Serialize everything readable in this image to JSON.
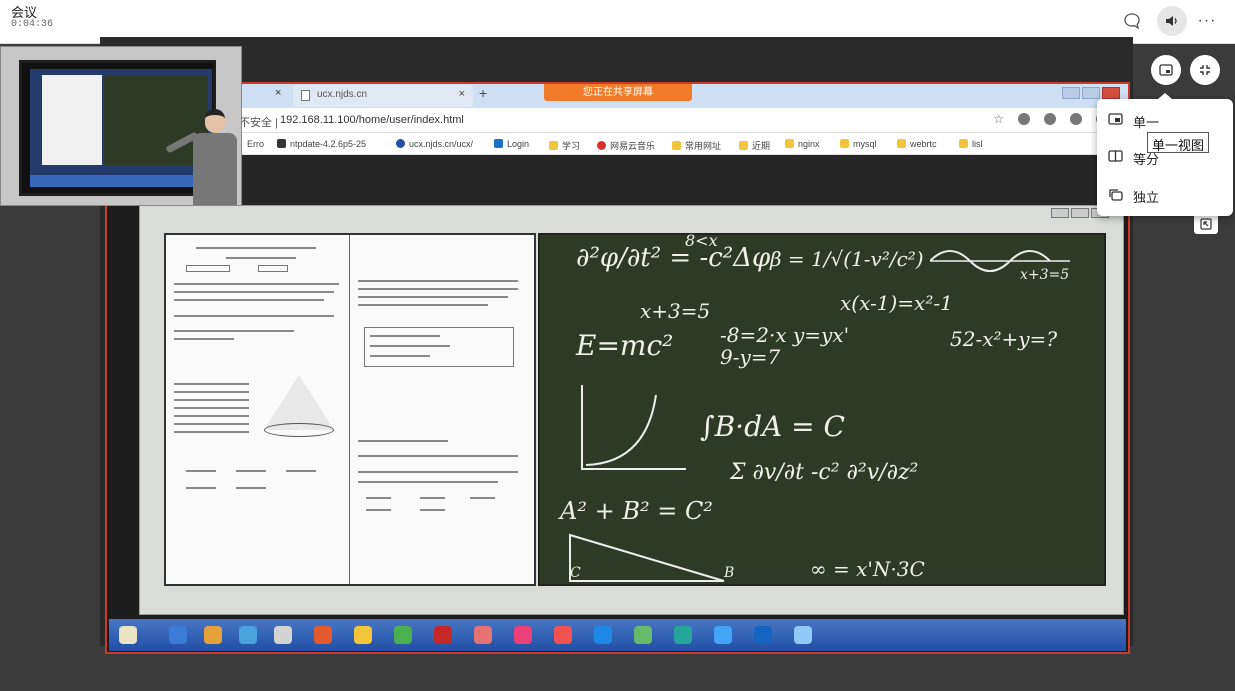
{
  "meeting": {
    "title": "会议",
    "timer": "0:04:36"
  },
  "toolbar": {
    "more_label": "···"
  },
  "shared_screen": {
    "sharing_banner": "您正在共享屏幕",
    "tabs": [
      {
        "label": "ucx.njds.cn"
      }
    ],
    "tab_close": "×",
    "new_tab": "+",
    "address_prefix": "不安全 |",
    "url": "192.168.11.100/home/user/index.html",
    "bookmarks": [
      {
        "label": "Erro",
        "icon": "error-icon"
      },
      {
        "label": "ntpdate-4.2.6p5-25",
        "icon": "page-icon"
      },
      {
        "label": "ucx.njds.cn/ucx/",
        "icon": "site-icon"
      },
      {
        "label": "Login",
        "icon": "login-icon"
      },
      {
        "label": "学习",
        "icon": "folder-icon"
      },
      {
        "label": "网易云音乐",
        "icon": "music-icon"
      },
      {
        "label": "常用网址",
        "icon": "folder-icon"
      },
      {
        "label": "近期",
        "icon": "folder-icon"
      },
      {
        "label": "nginx",
        "icon": "folder-icon"
      },
      {
        "label": "mysql",
        "icon": "folder-icon"
      },
      {
        "label": "webrtc",
        "icon": "folder-icon"
      },
      {
        "label": "lisl",
        "icon": "folder-icon"
      }
    ],
    "chalkboard_formulas": [
      "∂²φ/∂t² = -c²Δφ",
      "8<x",
      "β = 1/√(1-v²/c²)",
      "x+3=5",
      "x(x-1)=x²-1",
      "x+3=5",
      "E=mc²",
      "-8=2·x  y=yx'",
      "9-y=7",
      "52-x²+y=?",
      "∫B·dA = C",
      "Σ ∂v/∂t  -c²  ∂²v/∂z²",
      "A² + B² = C²",
      "∞ = x'N·3C",
      "B",
      "C"
    ]
  },
  "layout_menu": {
    "items": [
      {
        "label": "单一",
        "icon": "single-view-icon"
      },
      {
        "label": "等分",
        "icon": "split-view-icon"
      },
      {
        "label": "独立",
        "icon": "standalone-view-icon"
      }
    ],
    "tooltip": "单一视图"
  }
}
